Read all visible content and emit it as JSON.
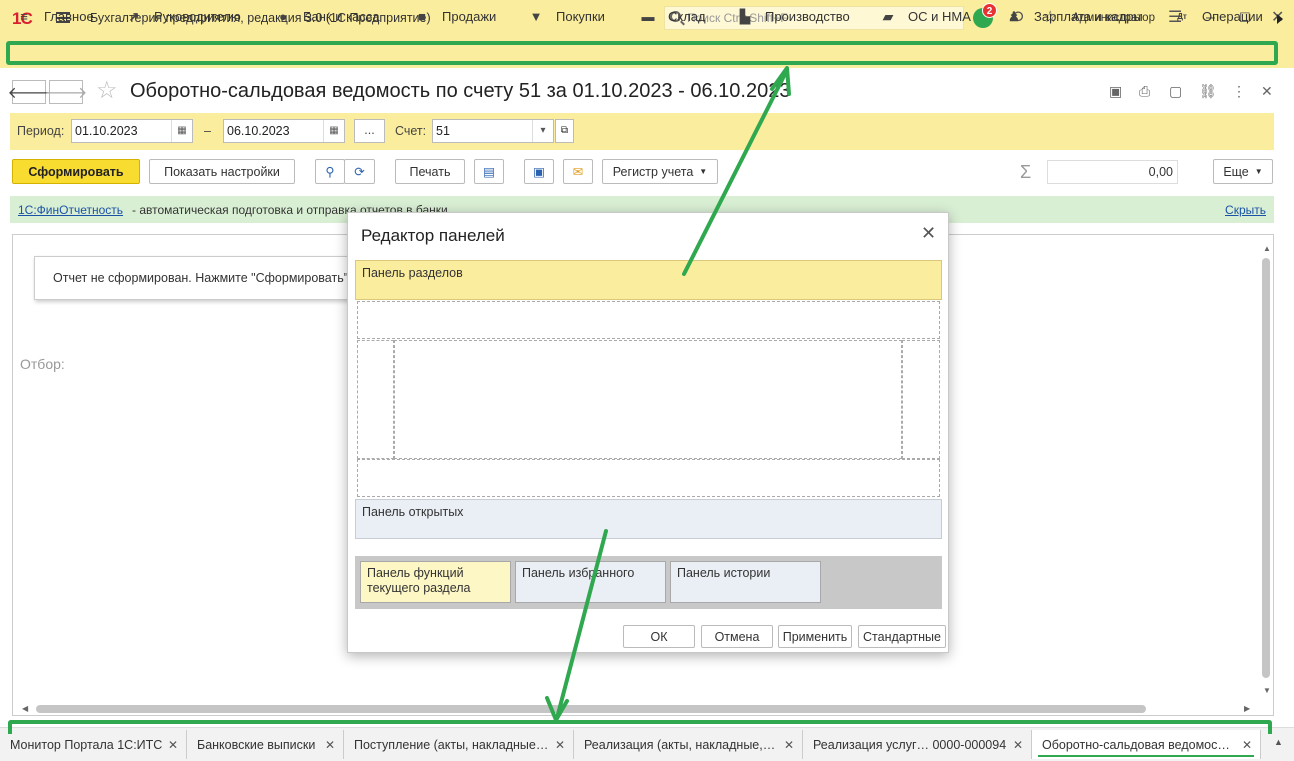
{
  "app": {
    "logo": "1С",
    "title": "Бухгалтерия предприятия, редакция 3.0  (1С:Предприятие)",
    "search_placeholder": "Поиск Ctrl+Shift+F",
    "notifications_count": "2",
    "user": "Администратор"
  },
  "sections": [
    {
      "label": "Главное",
      "icon": "menu-icon"
    },
    {
      "label": "Руководителю",
      "icon": "trend-icon"
    },
    {
      "label": "Банк и касса",
      "icon": "coin-icon"
    },
    {
      "label": "Продажи",
      "icon": "bag-icon"
    },
    {
      "label": "Покупки",
      "icon": "cart-icon"
    },
    {
      "label": "Склад",
      "icon": "warehouse-icon"
    },
    {
      "label": "Производство",
      "icon": "factory-icon"
    },
    {
      "label": "ОС и НМА",
      "icon": "truck-icon"
    },
    {
      "label": "Зарплата и кадры",
      "icon": "person-icon"
    },
    {
      "label": "Операции",
      "icon": "dt-kt-icon"
    }
  ],
  "form": {
    "title": "Оборотно-сальдовая ведомость по счету 51 за 01.10.2023 - 06.10.2023",
    "period_label": "Период:",
    "date_from": "01.10.2023",
    "dash": "–",
    "date_to": "06.10.2023",
    "period_button": "...",
    "account_label": "Счет:",
    "account_value": "51"
  },
  "toolbar": {
    "generate": "Сформировать",
    "show_settings": "Показать настройки",
    "print": "Печать",
    "register": "Регистр учета",
    "sum_value": "0,00",
    "more": "Еще"
  },
  "infoband": {
    "link": "1С:ФинОтчетность",
    "text": "- автоматическая подготовка и отправка отчетов в банки",
    "hide": "Скрыть"
  },
  "report": {
    "notice": "Отчет не сформирован. Нажмите \"Сформировать\" для получения отчета.",
    "filter_label": "Отбор:"
  },
  "dialog": {
    "title": "Редактор панелей",
    "panel_sections": "Панель разделов",
    "panel_open": "Панель открытых",
    "panel_functions": "Панель функций текущего раздела",
    "panel_favorites": "Панель избранного",
    "panel_history": "Панель истории",
    "ok": "ОК",
    "cancel": "Отмена",
    "apply": "Применить",
    "standard": "Стандартные"
  },
  "tabs": [
    {
      "label": "Монитор Портала 1С:ИТС"
    },
    {
      "label": "Банковские выписки"
    },
    {
      "label": "Поступление (акты, накладные…"
    },
    {
      "label": "Реализация (акты, накладные,…"
    },
    {
      "label": "Реализация услуг… 0000-000094"
    },
    {
      "label": "Оборотно-сальдовая ведомос…"
    }
  ],
  "colors": {
    "panel_yellow": "#fbed9e",
    "highlight_green": "#2fa84f",
    "primary_button": "#f9dc30",
    "info_green": "#d9efd4",
    "link_blue": "#1a52a6"
  }
}
